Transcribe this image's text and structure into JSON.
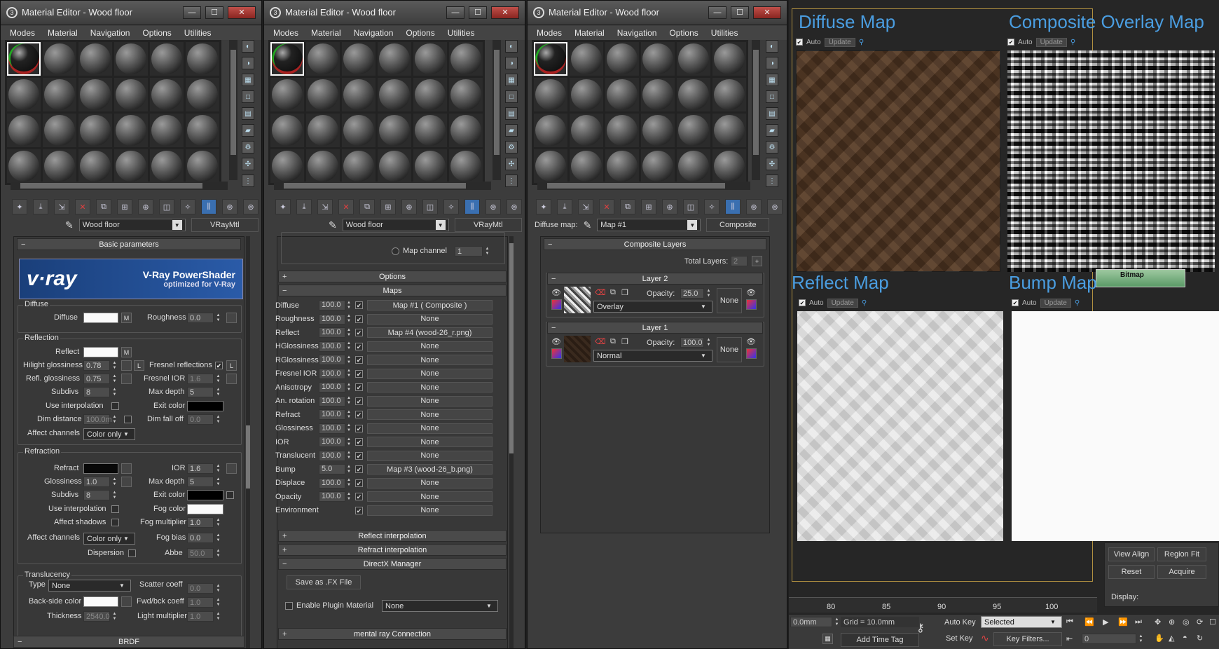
{
  "windows": [
    {
      "title": "Material Editor - Wood floor",
      "name_value": "Wood floor",
      "type_label": "VRayMtl"
    },
    {
      "title": "Material Editor - Wood floor",
      "name_value": "Wood floor",
      "type_label": "VRayMtl"
    },
    {
      "title": "Material Editor - Wood floor",
      "name_label": "Diffuse map:",
      "name_value": "Map #1",
      "type_label": "Composite"
    }
  ],
  "menu": [
    "Modes",
    "Material",
    "Navigation",
    "Options",
    "Utilities"
  ],
  "basic": {
    "rollout_title": "Basic parameters",
    "vray_title": "V-Ray PowerShader",
    "vray_sub": "optimized for V-Ray",
    "vray_logo": "v·ray",
    "diffuse_group": "Diffuse",
    "diffuse_label": "Diffuse",
    "roughness_label": "Roughness",
    "roughness": "0.0",
    "reflection_group": "Reflection",
    "reflect_label": "Reflect",
    "hilight_label": "Hilight glossiness",
    "hilight": "0.78",
    "fresnel_label": "Fresnel reflections",
    "refl_gloss_label": "Refl. glossiness",
    "refl_gloss": "0.75",
    "fresnel_ior_label": "Fresnel IOR",
    "fresnel_ior": "1.6",
    "subdivs_label": "Subdivs",
    "subdivs": "8",
    "max_depth_label": "Max depth",
    "max_depth": "5",
    "use_interp_label": "Use interpolation",
    "exit_color_label": "Exit color",
    "dim_distance_label": "Dim distance",
    "dim_distance": "100.0m",
    "dim_falloff_label": "Dim fall off",
    "dim_falloff": "0.0",
    "affect_channels_label": "Affect channels",
    "affect_channels": "Color only",
    "refraction_group": "Refraction",
    "refract_label": "Refract",
    "ior_label": "IOR",
    "ior": "1.6",
    "glossiness_label": "Glossiness",
    "glossiness": "1.0",
    "rmax_depth": "5",
    "rsubdivs": "8",
    "fog_color_label": "Fog color",
    "affect_shadows_label": "Affect shadows",
    "fog_mult_label": "Fog multiplier",
    "fog_mult": "1.0",
    "fog_bias_label": "Fog bias",
    "fog_bias": "0.0",
    "dispersion_label": "Dispersion",
    "abbe_label": "Abbe",
    "abbe": "50.0",
    "translucency_group": "Translucency",
    "type_label": "Type",
    "type_value": "None",
    "scatter_label": "Scatter coeff",
    "scatter": "0.0",
    "backside_label": "Back-side color",
    "fwd_label": "Fwd/bck coeff",
    "fwd": "1.0",
    "thickness_label": "Thickness",
    "thickness": "2540.0",
    "light_mult_label": "Light multiplier",
    "light_mult": "1.0",
    "brdf_title": "BRDF"
  },
  "maps": {
    "map_channel_label": "Map channel",
    "map_channel": "1",
    "options_title": "Options",
    "maps_title": "Maps",
    "rows": [
      {
        "label": "Diffuse",
        "value": "100.0",
        "map": "Map #1  ( Composite )"
      },
      {
        "label": "Roughness",
        "value": "100.0",
        "map": "None"
      },
      {
        "label": "Reflect",
        "value": "100.0",
        "map": "Map #4 (wood-26_r.png)"
      },
      {
        "label": "HGlossiness",
        "value": "100.0",
        "map": "None"
      },
      {
        "label": "RGlossiness",
        "value": "100.0",
        "map": "None"
      },
      {
        "label": "Fresnel IOR",
        "value": "100.0",
        "map": "None"
      },
      {
        "label": "Anisotropy",
        "value": "100.0",
        "map": "None"
      },
      {
        "label": "An. rotation",
        "value": "100.0",
        "map": "None"
      },
      {
        "label": "Refract",
        "value": "100.0",
        "map": "None"
      },
      {
        "label": "Glossiness",
        "value": "100.0",
        "map": "None"
      },
      {
        "label": "IOR",
        "value": "100.0",
        "map": "None"
      },
      {
        "label": "Translucent",
        "value": "100.0",
        "map": "None"
      },
      {
        "label": "Bump",
        "value": "5.0",
        "map": "Map #3 (wood-26_b.png)"
      },
      {
        "label": "Displace",
        "value": "100.0",
        "map": "None"
      },
      {
        "label": "Opacity",
        "value": "100.0",
        "map": "None"
      },
      {
        "label": "Environment",
        "value": "",
        "map": "None"
      }
    ],
    "reflect_interp_title": "Reflect interpolation",
    "refract_interp_title": "Refract interpolation",
    "directx_title": "DirectX Manager",
    "save_fx_label": "Save as .FX File",
    "enable_plugin_label": "Enable Plugin Material",
    "plugin_value": "None",
    "mental_ray_title": "mental ray Connection"
  },
  "composite": {
    "rollout_title": "Composite Layers",
    "total_layers_label": "Total Layers:",
    "total_layers": "2",
    "layers": [
      {
        "title": "Layer 2",
        "opacity_label": "Opacity:",
        "opacity": "25.0",
        "blend": "Overlay",
        "mask": "None"
      },
      {
        "title": "Layer 1",
        "opacity_label": "Opacity:",
        "opacity": "100.0",
        "blend": "Normal",
        "mask": "None"
      }
    ]
  },
  "viewports": {
    "diffuse": {
      "title": "Diffuse Map",
      "auto": "Auto",
      "update": "Update"
    },
    "composite": {
      "title": "Composite Overlay Map",
      "auto": "Auto",
      "update": "Update"
    },
    "reflect": {
      "title": "Reflect Map",
      "auto": "Auto",
      "update": "Update"
    },
    "bump": {
      "title": "Bump Map",
      "auto": "Auto",
      "update": "Update"
    },
    "bitmap_node": "Bitmap"
  },
  "status": {
    "ruler": [
      "80",
      "85",
      "90",
      "95",
      "100"
    ],
    "coord": "0.0mm",
    "grid": "Grid = 10.0mm",
    "auto_key": "Auto Key",
    "selected": "Selected",
    "set_key": "Set Key",
    "key_filters": "Key Filters...",
    "frame": "0",
    "add_time_tag": "Add Time Tag",
    "view_align": "View Align",
    "region_fit": "Region Fit",
    "reset": "Reset",
    "acquire": "Acquire",
    "display": "Display:"
  },
  "colors": {
    "accent": "#4a9de0",
    "panel": "#383838",
    "vray_blue": "#2a5ba8"
  }
}
